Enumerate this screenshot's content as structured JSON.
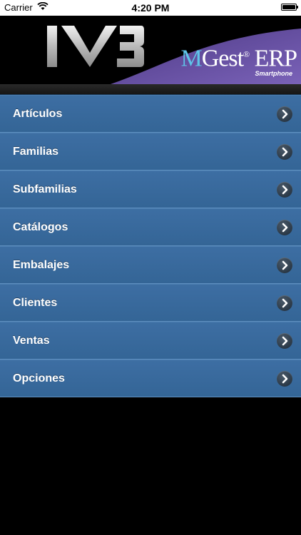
{
  "status_bar": {
    "carrier": "Carrier",
    "time": "4:20 PM",
    "wifi_icon": "wifi-icon",
    "battery_icon": "battery-icon",
    "battery_level": 1.0
  },
  "header": {
    "logo_text": "M3",
    "brand_prefix": "M",
    "brand_main": "Gest",
    "brand_reg": "®",
    "brand_suffix": " ERP",
    "brand_sub": "Smartphone",
    "colors": {
      "wave": "#6b4f9e",
      "brand_m": "#5fc4e8"
    }
  },
  "menu": {
    "items": [
      {
        "label": "Artículos",
        "icon": "chevron-right-icon"
      },
      {
        "label": "Familias",
        "icon": "chevron-right-icon"
      },
      {
        "label": "Subfamilias",
        "icon": "chevron-right-icon"
      },
      {
        "label": "Catálogos",
        "icon": "chevron-right-icon"
      },
      {
        "label": "Embalajes",
        "icon": "chevron-right-icon"
      },
      {
        "label": "Clientes",
        "icon": "chevron-right-icon"
      },
      {
        "label": "Ventas",
        "icon": "chevron-right-icon"
      },
      {
        "label": "Opciones",
        "icon": "chevron-right-icon"
      }
    ],
    "colors": {
      "row": "#3a6b9f",
      "divider": "#5e8fbf"
    }
  }
}
